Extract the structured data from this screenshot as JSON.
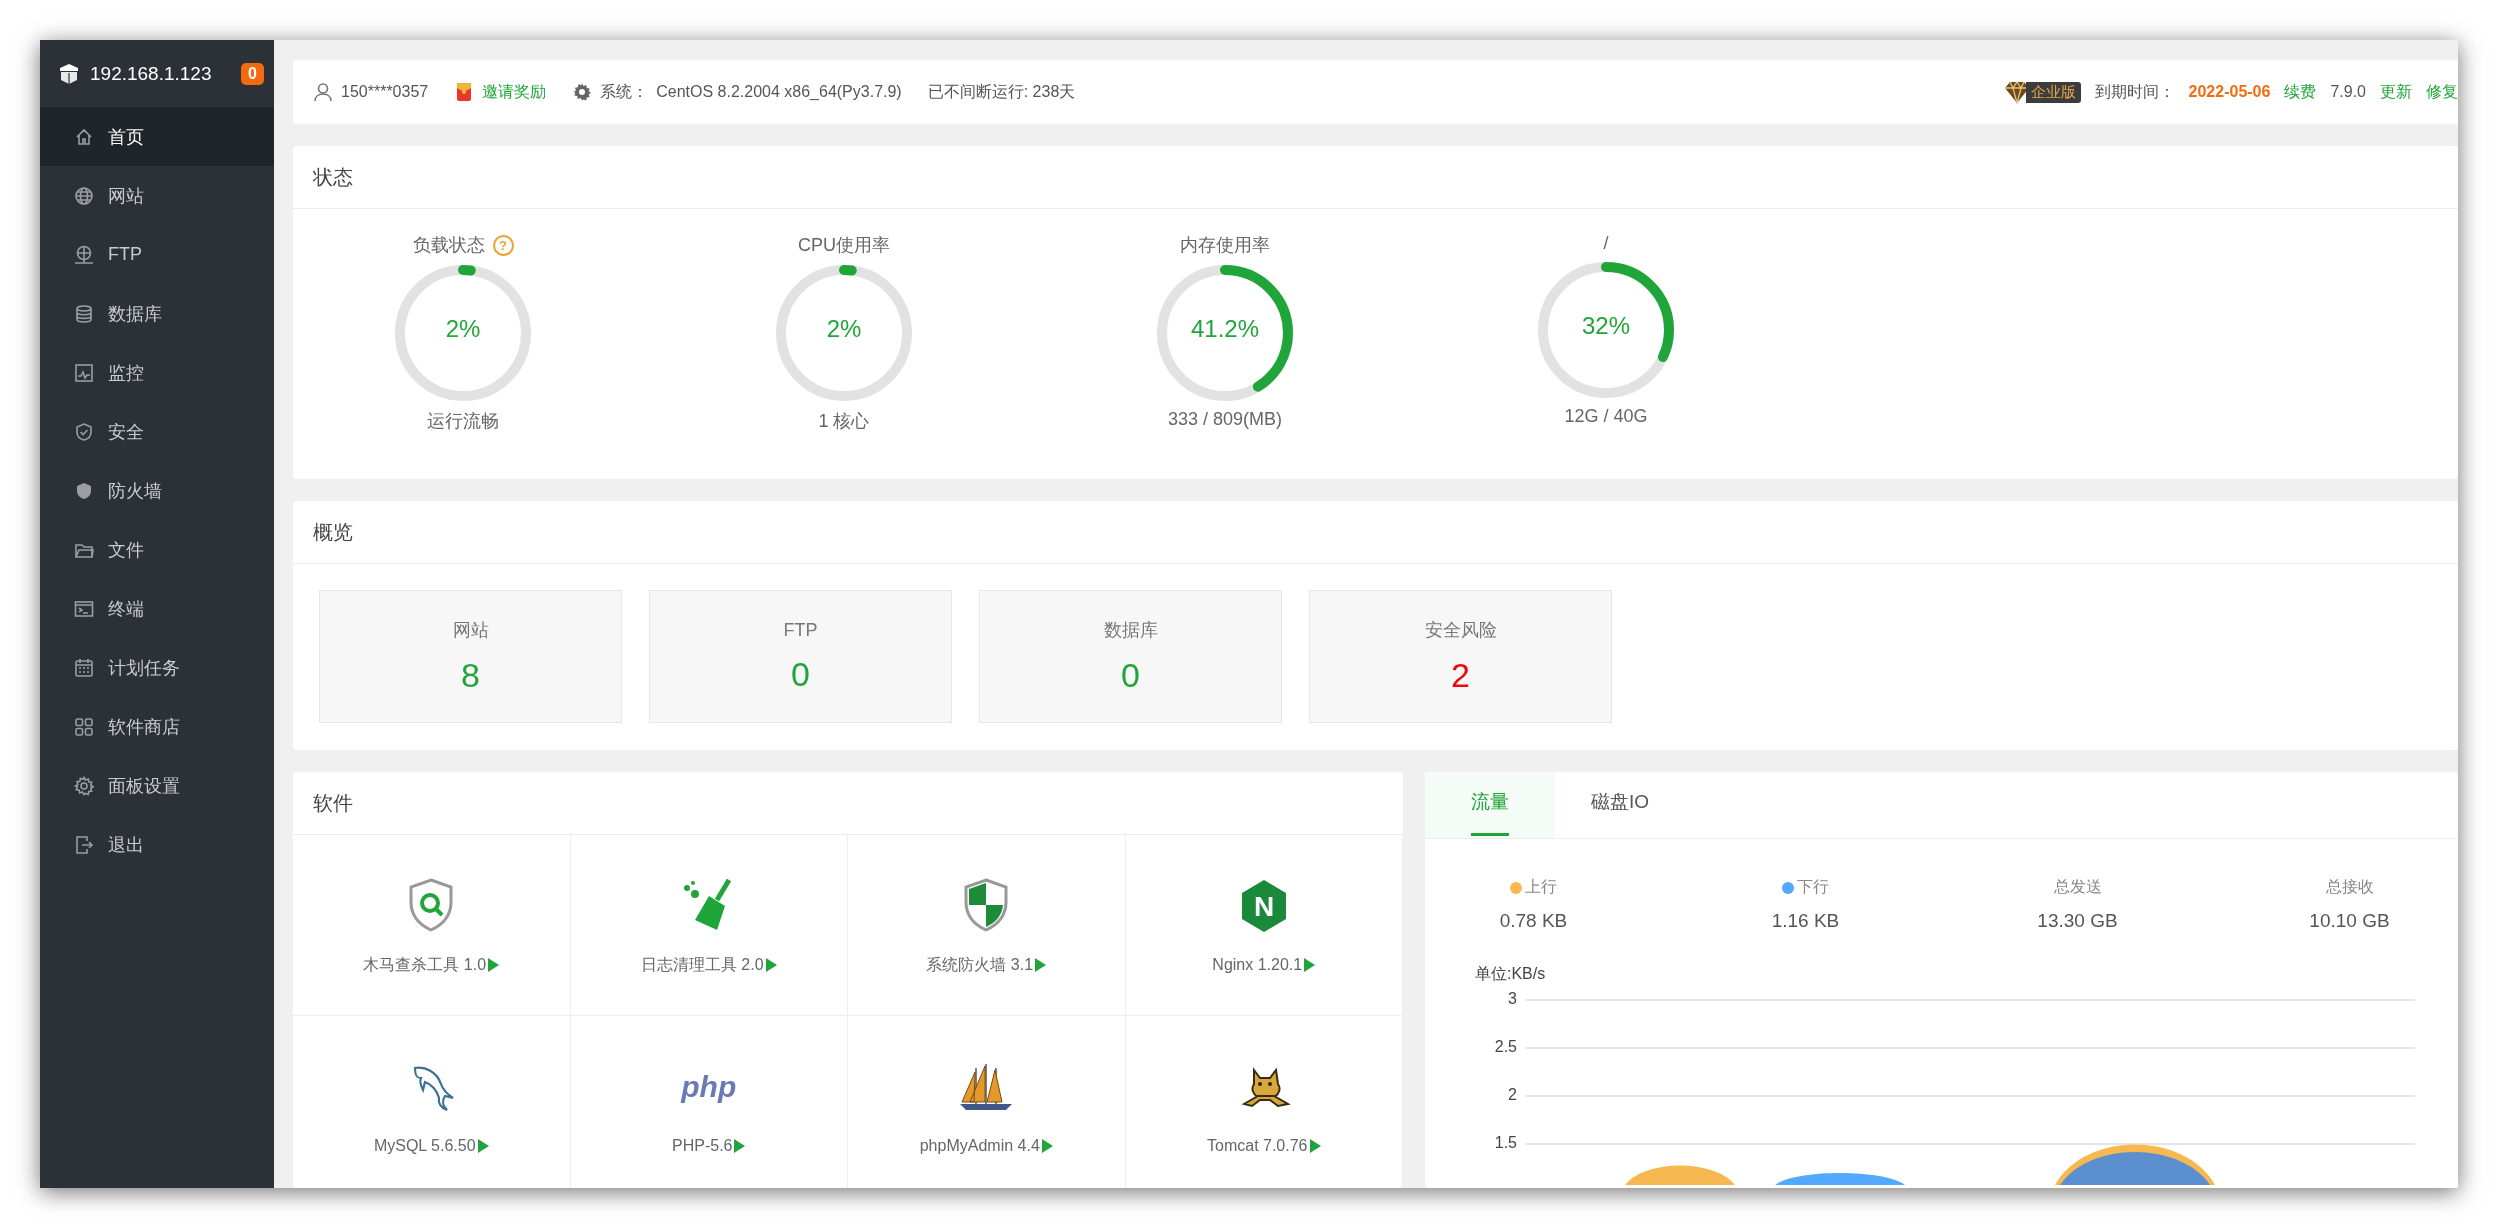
{
  "sidebar": {
    "host": "192.168.1.123",
    "badge": "0",
    "items": [
      {
        "label": "首页",
        "selected": true
      },
      {
        "label": "网站",
        "selected": false
      },
      {
        "label": "FTP",
        "selected": false
      },
      {
        "label": "数据库",
        "selected": false
      },
      {
        "label": "监控",
        "selected": false
      },
      {
        "label": "安全",
        "selected": false
      },
      {
        "label": "防火墙",
        "selected": false
      },
      {
        "label": "文件",
        "selected": false
      },
      {
        "label": "终端",
        "selected": false
      },
      {
        "label": "计划任务",
        "selected": false
      },
      {
        "label": "软件商店",
        "selected": false
      },
      {
        "label": "面板设置",
        "selected": false
      },
      {
        "label": "退出",
        "selected": false
      }
    ]
  },
  "top_bar": {
    "user": "150****0357",
    "invite": "邀请奖励",
    "system_label": "系统：",
    "system": "CentOS 8.2.2004 x86_64(Py3.7.9)",
    "uptime": "已不间断运行: 238天",
    "edition": "企业版",
    "expiry_label": "到期时间：",
    "expiry": "2022-05-06",
    "renew": "续费",
    "version": "7.9.0",
    "update": "更新",
    "repair": "修复"
  },
  "status": {
    "title": "状态",
    "gauges": [
      {
        "title": "负载状态",
        "help": "?",
        "value": "2%",
        "level": 0.02,
        "caption": "运行流畅"
      },
      {
        "title": "CPU使用率",
        "value": "2%",
        "level": 0.02,
        "caption": "1 核心"
      },
      {
        "title": "内存使用率",
        "value": "41.2%",
        "level": 0.412,
        "caption": "333 / 809(MB)"
      },
      {
        "title": "/",
        "value": "32%",
        "level": 0.32,
        "caption": "12G / 40G"
      }
    ]
  },
  "overview": {
    "title": "概览",
    "cards": [
      {
        "label": "网站",
        "value": "8",
        "color": "#20a53a"
      },
      {
        "label": "FTP",
        "value": "0",
        "color": "#20a53a"
      },
      {
        "label": "数据库",
        "value": "0",
        "color": "#20a53a"
      },
      {
        "label": "安全风险",
        "value": "2",
        "color": "#ef0808"
      }
    ]
  },
  "software": {
    "title": "软件",
    "items": [
      {
        "name": "木马查杀工具 1.0"
      },
      {
        "name": "日志清理工具 2.0"
      },
      {
        "name": "系统防火墙 3.1"
      },
      {
        "name": "Nginx 1.20.1",
        "logo_text": "N"
      },
      {
        "name": "MySQL 5.6.50"
      },
      {
        "name": "PHP-5.6",
        "logo_text": "php"
      },
      {
        "name": "phpMyAdmin 4.4"
      },
      {
        "name": "Tomcat 7.0.76"
      }
    ]
  },
  "traffic": {
    "tabs": [
      {
        "label": "流量",
        "selected": true
      },
      {
        "label": "磁盘IO",
        "selected": false
      }
    ],
    "stats": [
      {
        "label": "上行",
        "value": "0.78 KB",
        "color": "#f7b851"
      },
      {
        "label": "下行",
        "value": "1.16 KB",
        "color": "#52a9ff"
      },
      {
        "label": "总发送",
        "value": "13.30 GB"
      },
      {
        "label": "总接收",
        "value": "10.10 GB"
      }
    ],
    "chart": {
      "unit": "单位:KB/s",
      "y_labels": [
        "3",
        "2.5",
        "2",
        "1.5"
      ]
    }
  }
}
